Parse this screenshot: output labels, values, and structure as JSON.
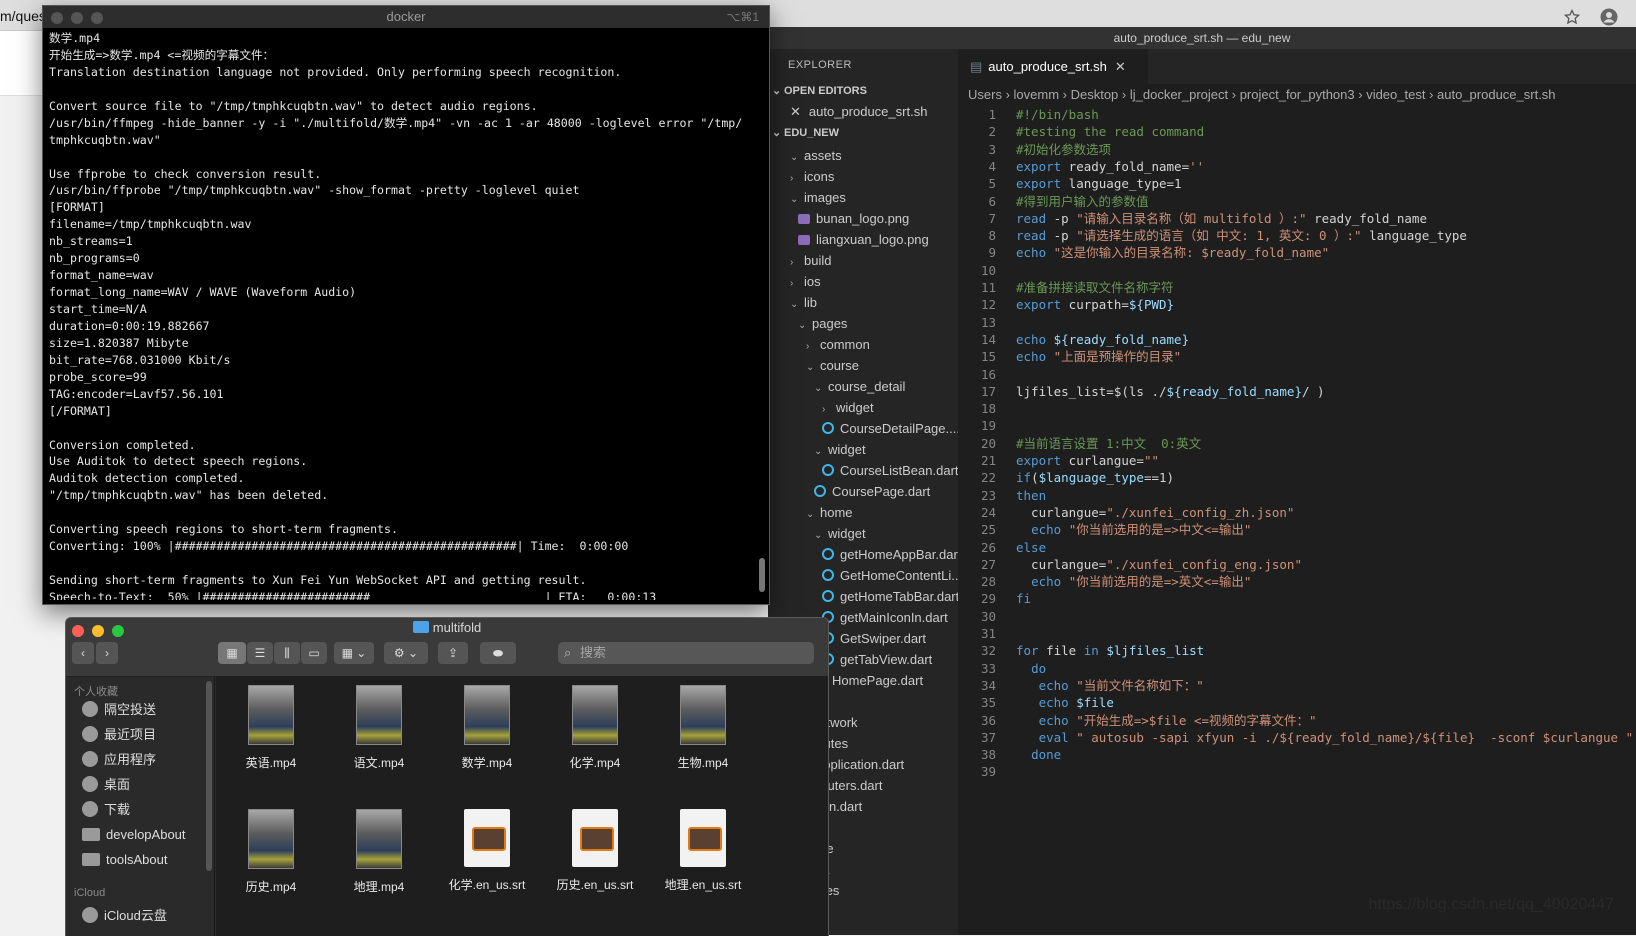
{
  "browser": {
    "url_fragment": "m/ques"
  },
  "terminal": {
    "title": "docker",
    "shortcut": "⌥⌘1",
    "lines": [
      "数学.mp4",
      "开始生成=>数学.mp4 <=视频的字幕文件：",
      "Translation destination language not provided. Only performing speech recognition.",
      "",
      "Convert source file to \"/tmp/tmphkcuqbtn.wav\" to detect audio regions.",
      "/usr/bin/ffmpeg -hide_banner -y -i \"./multifold/数学.mp4\" -vn -ac 1 -ar 48000 -loglevel error \"/tmp/",
      "tmphkcuqbtn.wav\"",
      "",
      "Use ffprobe to check conversion result.",
      "/usr/bin/ffprobe \"/tmp/tmphkcuqbtn.wav\" -show_format -pretty -loglevel quiet",
      "[FORMAT]",
      "filename=/tmp/tmphkcuqbtn.wav",
      "nb_streams=1",
      "nb_programs=0",
      "format_name=wav",
      "format_long_name=WAV / WAVE (Waveform Audio)",
      "start_time=N/A",
      "duration=0:00:19.882667",
      "size=1.820387 Mibyte",
      "bit_rate=768.031000 Kbit/s",
      "probe_score=99",
      "TAG:encoder=Lavf57.56.101",
      "[/FORMAT]",
      "",
      "Conversion completed.",
      "Use Auditok to detect speech regions.",
      "Auditok detection completed.",
      "\"/tmp/tmphkcuqbtn.wav\" has been deleted.",
      "",
      "Converting speech regions to short-term fragments.",
      "Converting: 100% |#################################################| Time:  0:00:00",
      "",
      "Sending short-term fragments to Xun Fei Yun WebSocket API and getting result.",
      "Speech-to-Text:  50% |########################                         | ETA:   0:00:13"
    ]
  },
  "vscode": {
    "window_title": "auto_produce_srt.sh — edu_new",
    "explorer_title": "EXPLORER",
    "open_editors_label": "OPEN EDITORS",
    "open_editor_file": "auto_produce_srt.sh",
    "project_label": "EDU_NEW",
    "tree": [
      {
        "label": "assets",
        "indent": 1,
        "kind": "folder-open"
      },
      {
        "label": "icons",
        "indent": 1,
        "kind": "folder"
      },
      {
        "label": "images",
        "indent": 1,
        "kind": "folder-open"
      },
      {
        "label": "bunan_logo.png",
        "indent": 2,
        "kind": "image"
      },
      {
        "label": "liangxuan_logo.png",
        "indent": 2,
        "kind": "image"
      },
      {
        "label": "build",
        "indent": 1,
        "kind": "folder"
      },
      {
        "label": "ios",
        "indent": 1,
        "kind": "folder"
      },
      {
        "label": "lib",
        "indent": 1,
        "kind": "folder-open"
      },
      {
        "label": "pages",
        "indent": 2,
        "kind": "folder-open"
      },
      {
        "label": "common",
        "indent": 3,
        "kind": "folder"
      },
      {
        "label": "course",
        "indent": 3,
        "kind": "folder-open"
      },
      {
        "label": "course_detail",
        "indent": 4,
        "kind": "folder-open"
      },
      {
        "label": "widget",
        "indent": 5,
        "kind": "folder"
      },
      {
        "label": "CourseDetailPage....",
        "indent": 5,
        "kind": "dart"
      },
      {
        "label": "widget",
        "indent": 4,
        "kind": "folder-open"
      },
      {
        "label": "CourseListBean.dart",
        "indent": 5,
        "kind": "dart"
      },
      {
        "label": "CoursePage.dart",
        "indent": 4,
        "kind": "dart"
      },
      {
        "label": "home",
        "indent": 3,
        "kind": "folder-open"
      },
      {
        "label": "widget",
        "indent": 4,
        "kind": "folder-open"
      },
      {
        "label": "getHomeAppBar.dart",
        "indent": 5,
        "kind": "dart"
      },
      {
        "label": "GetHomeContentLi...",
        "indent": 5,
        "kind": "dart"
      },
      {
        "label": "getHomeTabBar.dart",
        "indent": 5,
        "kind": "dart"
      },
      {
        "label": "getMainIconIn.dart",
        "indent": 5,
        "kind": "dart"
      },
      {
        "label": "GetSwiper.dart",
        "indent": 5,
        "kind": "dart"
      },
      {
        "label": "getTabView.dart",
        "indent": 5,
        "kind": "dart"
      },
      {
        "label": "HomePage.dart",
        "indent": 4,
        "kind": "dart"
      },
      {
        "label": "",
        "indent": 3,
        "kind": "folder"
      },
      {
        "label": "network",
        "indent": 2,
        "kind": "folder"
      },
      {
        "label": "routes",
        "indent": 2,
        "kind": "folder"
      },
      {
        "label": "application.dart",
        "indent": 2,
        "kind": "dart"
      },
      {
        "label": "routers.dart",
        "indent": 2,
        "kind": "dart"
      },
      {
        "label": "main.dart",
        "indent": 1,
        "kind": "dart"
      },
      {
        "label": "",
        "indent": 1,
        "kind": "folder"
      },
      {
        "label": "more",
        "indent": 1,
        "kind": "folder"
      },
      {
        "label": "data",
        "indent": 1,
        "kind": "folder"
      },
      {
        "label": "pages",
        "indent": 1,
        "kind": "folder"
      }
    ],
    "tab_label": "auto_produce_srt.sh",
    "breadcrumb": [
      "Users",
      "lovemm",
      "Desktop",
      "lj_docker_project",
      "project_for_python3",
      "video_test",
      "auto_produce_srt.sh"
    ],
    "code": [
      "#!/bin/bash",
      "#testing the read command",
      "#初始化参数选项",
      "export ready_fold_name=''",
      "export language_type=1",
      "#得到用户输入的参数值",
      "read -p \"请输入目录名称（如 multifold ）:\" ready_fold_name",
      "read -p \"请选择生成的语言（如 中文: 1, 英文: 0 ）:\" language_type",
      "echo \"这是你输入的目录名称: $ready_fold_name\"",
      "",
      "#准备拼接读取文件名称字符",
      "export curpath=${PWD}",
      "",
      "echo ${ready_fold_name}",
      "echo \"上面是预操作的目录\"",
      "",
      "ljfiles_list=$(ls ./${ready_fold_name}/ )",
      "",
      "",
      "#当前语言设置 1:中文  0:英文",
      "export curlangue=\"\"",
      "if($language_type==1)",
      "then",
      "  curlangue=\"./xunfei_config_zh.json\"",
      "  echo \"你当前选用的是=>中文<=输出\"",
      "else",
      "  curlangue=\"./xunfei_config_eng.json\"",
      "  echo \"你当前选用的是=>英文<=输出\"",
      "fi",
      "",
      "",
      "for file in $ljfiles_list",
      "  do",
      "   echo \"当前文件名称如下：\"",
      "   echo $file",
      "   echo \"开始生成=>$file <=视频的字幕文件：\"",
      "   eval \" autosub -sapi xfyun -i ./${ready_fold_name}/${file}  -sconf $curlangue \"",
      "  done",
      ""
    ],
    "colors": {
      "keyword": "#569cd6",
      "string": "#ce9178",
      "comment": "#6a9955",
      "variable": "#9cdcfe"
    }
  },
  "finder": {
    "title": "multifold",
    "search_placeholder": "搜索",
    "favorites_label": "个人收藏",
    "icloud_label": "iCloud",
    "sidebar_items": [
      {
        "label": "隔空投送",
        "icon": "airdrop-icon"
      },
      {
        "label": "最近项目",
        "icon": "recents-icon"
      },
      {
        "label": "应用程序",
        "icon": "applications-icon"
      },
      {
        "label": "桌面",
        "icon": "desktop-icon"
      },
      {
        "label": "下载",
        "icon": "downloads-icon"
      },
      {
        "label": "developAbout",
        "icon": "folder-icon"
      },
      {
        "label": "toolsAbout",
        "icon": "folder-icon"
      }
    ],
    "icloud_item": "iCloud云盘",
    "files": [
      {
        "name": "英语.mp4",
        "type": "mp4"
      },
      {
        "name": "语文.mp4",
        "type": "mp4"
      },
      {
        "name": "数学.mp4",
        "type": "mp4"
      },
      {
        "name": "化学.mp4",
        "type": "mp4"
      },
      {
        "name": "生物.mp4",
        "type": "mp4"
      },
      {
        "name": "历史.mp4",
        "type": "mp4"
      },
      {
        "name": "地理.mp4",
        "type": "mp4"
      },
      {
        "name": "化学.en_us.srt",
        "type": "srt"
      },
      {
        "name": "历史.en_us.srt",
        "type": "srt"
      },
      {
        "name": "地理.en_us.srt",
        "type": "srt"
      }
    ]
  },
  "watermark": "https://blog.csdn.net/qq_40020447"
}
